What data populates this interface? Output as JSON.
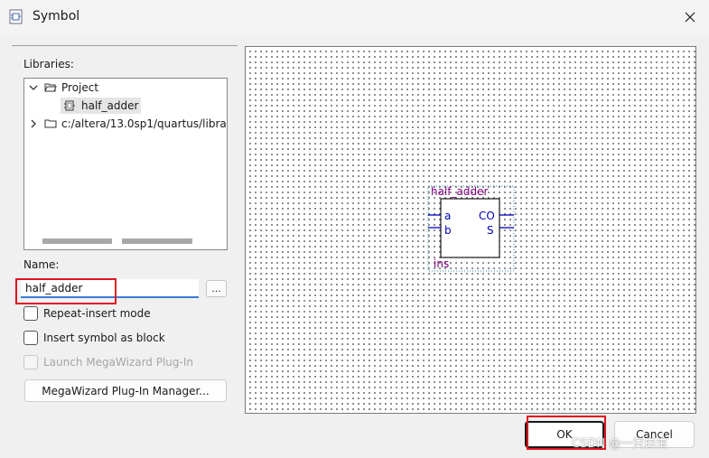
{
  "window": {
    "title": "Symbol"
  },
  "libraries": {
    "label": "Libraries:",
    "items": [
      {
        "label": "Project"
      },
      {
        "label": "half_adder"
      },
      {
        "label": "c:/altera/13.0sp1/quartus/librar"
      }
    ]
  },
  "name": {
    "label": "Name:",
    "value": "half_adder",
    "browse_label": "..."
  },
  "options": [
    {
      "label": "Repeat-insert mode",
      "checked": false
    },
    {
      "label": "Insert symbol as block",
      "checked": false
    },
    {
      "label": "Launch MegaWizard Plug-In",
      "checked": false
    }
  ],
  "megawizard_button": "MegaWizard Plug-In Manager...",
  "symbol": {
    "name": "half_adder",
    "instance": "ins",
    "inputs": [
      "a",
      "b"
    ],
    "outputs": [
      "CO",
      "S"
    ]
  },
  "buttons": {
    "ok": "OK",
    "cancel": "Cancel"
  },
  "watermark": "CSDN @一只白虫",
  "colors": {
    "symbol_text": "#800080",
    "pin_text": "#0000c0",
    "highlight": "#e0141e",
    "focus": "#3a7bd5"
  }
}
